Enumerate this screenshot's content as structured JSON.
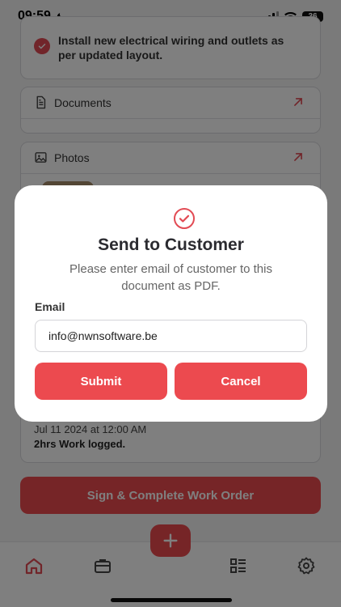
{
  "status_bar": {
    "time": "09:59",
    "battery": "36"
  },
  "task": {
    "text": "Install new electrical wiring and outlets as per updated layout."
  },
  "sections": {
    "documents": "Documents",
    "photos": "Photos"
  },
  "log": {
    "date": "Jul 11 2024 at 12:00 AM",
    "text": "2hrs Work logged."
  },
  "sign_button": "Sign & Complete Work Order",
  "modal": {
    "title": "Send to Customer",
    "description": "Please enter email of customer to this document as PDF.",
    "email_label": "Email",
    "email_value": "info@nwnsoftware.be",
    "submit_label": "Submit",
    "cancel_label": "Cancel"
  },
  "colors": {
    "accent": "#ec4a4f",
    "overlay": "rgba(0,0,0,0.5)"
  },
  "icons": {
    "tabs": [
      "home-icon",
      "briefcase-icon",
      "list-icon",
      "gear-icon"
    ],
    "fab": "plus-icon",
    "modal": "check-circle-icon"
  }
}
